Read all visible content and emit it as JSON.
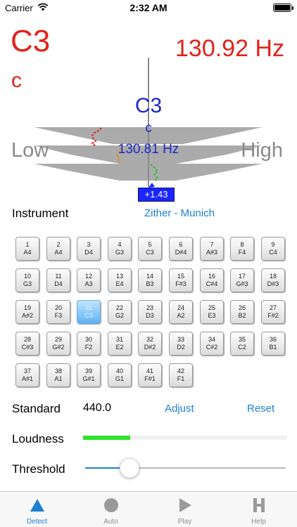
{
  "status_bar": {
    "carrier": "Carrier",
    "time": "2:32 AM"
  },
  "detected": {
    "note": "C3",
    "sub": "c",
    "frequency": "130.92 Hz"
  },
  "target": {
    "note": "C3",
    "sub": "c",
    "frequency": "130.81 Hz",
    "cents": "+1.43"
  },
  "gauge": {
    "low_label": "Low",
    "high_label": "High"
  },
  "instrument": {
    "label": "Instrument",
    "value": "Zither - Munich"
  },
  "keys": [
    {
      "num": "1",
      "note": "A4"
    },
    {
      "num": "2",
      "note": "A4"
    },
    {
      "num": "3",
      "note": "D4"
    },
    {
      "num": "4",
      "note": "G3"
    },
    {
      "num": "5",
      "note": "C3"
    },
    {
      "num": "6",
      "note": "D#4"
    },
    {
      "num": "7",
      "note": "A#3"
    },
    {
      "num": "8",
      "note": "F4"
    },
    {
      "num": "9",
      "note": "C4"
    },
    {
      "num": "10",
      "note": "G3"
    },
    {
      "num": "11",
      "note": "D4"
    },
    {
      "num": "12",
      "note": "A3"
    },
    {
      "num": "13",
      "note": "E4"
    },
    {
      "num": "14",
      "note": "B3"
    },
    {
      "num": "15",
      "note": "F#3"
    },
    {
      "num": "16",
      "note": "C#4"
    },
    {
      "num": "17",
      "note": "G#3"
    },
    {
      "num": "18",
      "note": "D#3"
    },
    {
      "num": "19",
      "note": "A#2"
    },
    {
      "num": "20",
      "note": "F3"
    },
    {
      "num": "21",
      "note": "C3"
    },
    {
      "num": "22",
      "note": "G2"
    },
    {
      "num": "23",
      "note": "D3"
    },
    {
      "num": "24",
      "note": "A2"
    },
    {
      "num": "25",
      "note": "E3"
    },
    {
      "num": "26",
      "note": "B2"
    },
    {
      "num": "27",
      "note": "F#2"
    },
    {
      "num": "28",
      "note": "C#3"
    },
    {
      "num": "29",
      "note": "G#2"
    },
    {
      "num": "30",
      "note": "F2"
    },
    {
      "num": "31",
      "note": "E2"
    },
    {
      "num": "32",
      "note": "D#2"
    },
    {
      "num": "33",
      "note": "D2"
    },
    {
      "num": "34",
      "note": "C#2"
    },
    {
      "num": "35",
      "note": "C2"
    },
    {
      "num": "36",
      "note": "B1"
    },
    {
      "num": "37",
      "note": "A#1"
    },
    {
      "num": "38",
      "note": "A1"
    },
    {
      "num": "39",
      "note": "G#1"
    },
    {
      "num": "40",
      "note": "G1"
    },
    {
      "num": "41",
      "note": "F#1"
    },
    {
      "num": "42",
      "note": "F1"
    }
  ],
  "active_key": "21",
  "standard": {
    "label": "Standard",
    "value": "440.0",
    "adjust": "Adjust",
    "reset": "Reset"
  },
  "loudness": {
    "label": "Loudness",
    "level": 0.23
  },
  "threshold": {
    "label": "Threshold",
    "value": 0.22
  },
  "tabs": [
    {
      "label": "Detect",
      "icon": "triangle-icon",
      "selected": true
    },
    {
      "label": "Auto",
      "icon": "circle-icon",
      "selected": false
    },
    {
      "label": "Play",
      "icon": "play-icon",
      "selected": false
    },
    {
      "label": "Help",
      "icon": "help-h-icon",
      "selected": false
    }
  ],
  "colors": {
    "detected": "#e2231a",
    "target": "#1d27c9",
    "accent": "#1e7fd4",
    "loudness": "#2ee32a",
    "active_key": "#5fb1f5"
  }
}
